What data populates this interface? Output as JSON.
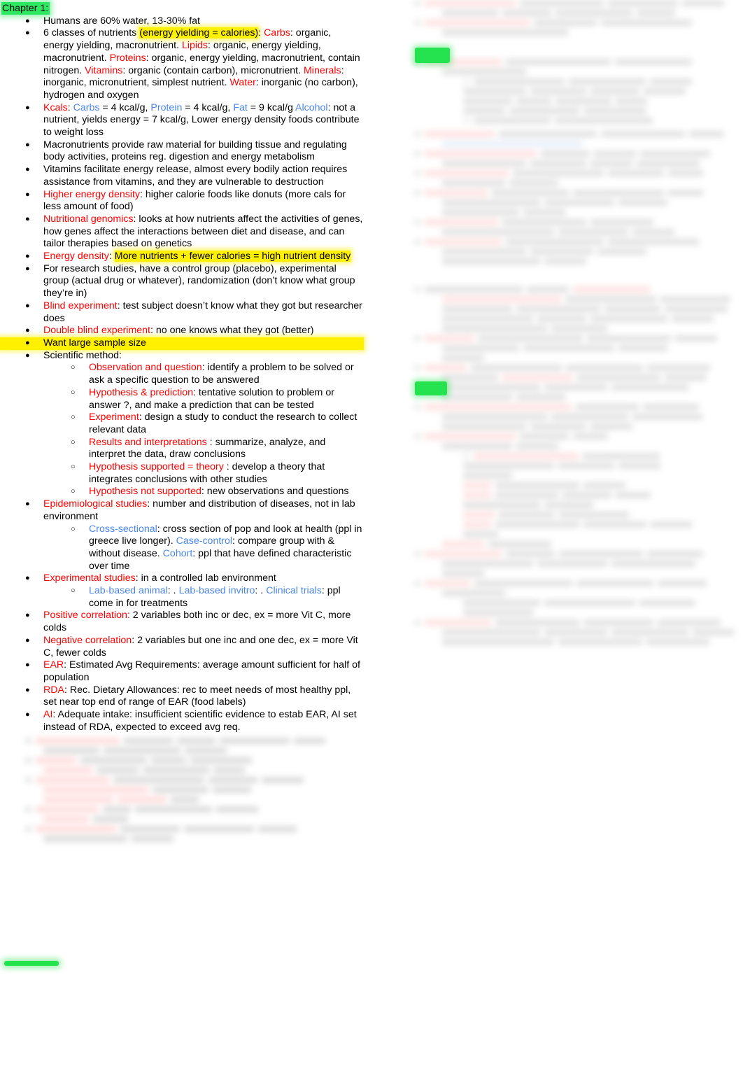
{
  "document": {
    "title": "Chapter 1:",
    "title_highlight": "green",
    "colors": {
      "term_red": "#ff0000",
      "term_blue": "#4a86e8",
      "highlight_yellow": "#fff000",
      "highlight_green": "#2ee861",
      "body_text": "#000000"
    }
  },
  "left_column": {
    "heading": "Chapter 1:",
    "bullets": [
      {
        "id": "humans-water-fat",
        "parts": [
          {
            "text": "Humans are 60% water, 13-30% fat",
            "color": "black"
          }
        ]
      },
      {
        "id": "six-classes-nutrients",
        "parts": [
          {
            "text": "6 classes of nutrients ",
            "color": "black"
          },
          {
            "text": "(energy yielding = calories)",
            "color": "black",
            "highlight": "yellow"
          },
          {
            "text": ": ",
            "color": "black"
          },
          {
            "text": "Carbs",
            "color": "red"
          },
          {
            "text": ": organic, energy yielding, macronutrient. ",
            "color": "black"
          },
          {
            "text": "Lipids",
            "color": "red"
          },
          {
            "text": ": organic, energy yielding, macronutrient. ",
            "color": "black"
          },
          {
            "text": "Proteins",
            "color": "red"
          },
          {
            "text": ": organic, energy yielding, macronutrient, contain nitrogen. ",
            "color": "black"
          },
          {
            "text": "Vitamins",
            "color": "red"
          },
          {
            "text": ": organic (contain carbon), micronutrient. ",
            "color": "black"
          },
          {
            "text": "Minerals",
            "color": "red"
          },
          {
            "text": ": inorganic, micronutrient, simplest nutrient. ",
            "color": "black"
          },
          {
            "text": "Water",
            "color": "red"
          },
          {
            "text": ": inorganic (no carbon), hydrogen and oxygen",
            "color": "black"
          }
        ]
      },
      {
        "id": "kcals",
        "parts": [
          {
            "text": "Kcals",
            "color": "red"
          },
          {
            "text": ": ",
            "color": "black"
          },
          {
            "text": "Carbs",
            "color": "blue"
          },
          {
            "text": " = 4 kcal/g, ",
            "color": "black"
          },
          {
            "text": "Protein",
            "color": "blue"
          },
          {
            "text": " = 4 kcal/g, ",
            "color": "black"
          },
          {
            "text": "Fat",
            "color": "blue"
          },
          {
            "text": " = 9 kcal/g ",
            "color": "black"
          },
          {
            "text": "Alcohol",
            "color": "blue"
          },
          {
            "text": ": not a nutrient, yields energy = 7 kcal/g, Lower energy density foods contribute to weight loss",
            "color": "black"
          }
        ]
      },
      {
        "id": "macronutrients-raw-material",
        "parts": [
          {
            "text": "Macronutrients provide raw material for building tissue and regulating body activities, proteins reg. digestion and energy metabolism",
            "color": "black"
          }
        ]
      },
      {
        "id": "vitamins-facilitate",
        "parts": [
          {
            "text": "Vitamins facilitate energy release, almost every bodily action requires assistance from vitamins, and they are vulnerable to destruction",
            "color": "black"
          }
        ]
      },
      {
        "id": "higher-energy-density",
        "parts": [
          {
            "text": "Higher energy density",
            "color": "red"
          },
          {
            "text": ": higher calorie foods like donuts (more cals for less amount of food)",
            "color": "black"
          }
        ]
      },
      {
        "id": "nutritional-genomics",
        "parts": [
          {
            "text": "Nutritional genomics",
            "color": "red"
          },
          {
            "text": ": looks at how nutrients affect the activities of genes, how genes affect the interactions between diet and disease, and can tailor therapies based on genetics",
            "color": "black"
          }
        ]
      },
      {
        "id": "energy-density",
        "parts": [
          {
            "text": "Energy density",
            "color": "red"
          },
          {
            "text": ": ",
            "color": "black"
          },
          {
            "text": "More nutrients + fewer calories = high nutrient density",
            "color": "black",
            "highlight": "yellow"
          }
        ]
      },
      {
        "id": "research-studies-groups",
        "parts": [
          {
            "text": "For research studies, have a control group (placebo), experimental group (actual drug or whatever), randomization (don’t know what group they’re in)",
            "color": "black"
          }
        ]
      },
      {
        "id": "blind-experiment",
        "parts": [
          {
            "text": "Blind experiment",
            "color": "red"
          },
          {
            "text": ": test subject doesn’t know what they got but researcher does",
            "color": "black"
          }
        ]
      },
      {
        "id": "double-blind-experiment",
        "parts": [
          {
            "text": "Double blind experiment",
            "color": "red"
          },
          {
            "text": ": no one knows what they got (better)",
            "color": "black"
          }
        ]
      },
      {
        "id": "want-large-sample-size",
        "highlight_whole_line": "yellow",
        "parts": [
          {
            "text": "Want large sample size",
            "color": "black"
          }
        ]
      },
      {
        "id": "scientific-method",
        "parts": [
          {
            "text": "Scientific method:",
            "color": "black"
          }
        ],
        "subbullets": [
          {
            "id": "observation-and-question",
            "parts": [
              {
                "text": "Observation and question",
                "color": "red"
              },
              {
                "text": ": identify a problem to be solved or ask a specific question to be answered",
                "color": "black"
              }
            ]
          },
          {
            "id": "hypothesis-and-prediction",
            "parts": [
              {
                "text": "Hypothesis & prediction",
                "color": "red"
              },
              {
                "text": ": tentative solution to problem or answer ?, and make a prediction that can be tested",
                "color": "black"
              }
            ]
          },
          {
            "id": "experiment",
            "parts": [
              {
                "text": "Experiment",
                "color": "red"
              },
              {
                "text": ": design a study to conduct the research to collect relevant data",
                "color": "black"
              }
            ]
          },
          {
            "id": "results-and-interpretations",
            "parts": [
              {
                "text": "Results and interpretations",
                "color": "red"
              },
              {
                "text": " : summarize, analyze, and interpret the data, draw conclusions",
                "color": "black"
              }
            ]
          },
          {
            "id": "hypothesis-supported-theory",
            "parts": [
              {
                "text": "Hypothesis supported = theory",
                "color": "red"
              },
              {
                "text": " : develop a theory that integrates conclusions with other studies",
                "color": "black"
              }
            ]
          },
          {
            "id": "hypothesis-not-supported",
            "parts": [
              {
                "text": "Hypothesis not supported",
                "color": "red"
              },
              {
                "text": ": new observations and questions",
                "color": "black"
              }
            ]
          }
        ]
      },
      {
        "id": "epidemiological-studies",
        "flat_wrap": true,
        "parts": [
          {
            "text": "Epidemiological studies",
            "color": "red"
          },
          {
            "text": ": number and distribution of diseases, not in lab environment",
            "color": "black"
          }
        ],
        "subbullets": [
          {
            "id": "cross-sectional-case-control-cohort",
            "parts": [
              {
                "text": "Cross-sectional",
                "color": "blue"
              },
              {
                "text": ": cross section of pop and look at health (ppl in greece live longer). ",
                "color": "black"
              },
              {
                "text": "Case-control",
                "color": "blue"
              },
              {
                "text": ": compare group with & without disease. ",
                "color": "black"
              },
              {
                "text": "Cohort",
                "color": "blue"
              },
              {
                "text": ": ppl that have defined characteristic over time",
                "color": "black"
              }
            ]
          }
        ]
      },
      {
        "id": "experimental-studies",
        "parts": [
          {
            "text": "Experimental studies",
            "color": "red"
          },
          {
            "text": ": in a controlled lab environment",
            "color": "black"
          }
        ],
        "subbullets": [
          {
            "id": "lab-based-animal-invitro-clinical",
            "parts": [
              {
                "text": "Lab-based animal",
                "color": "blue"
              },
              {
                "text": ": . ",
                "color": "black"
              },
              {
                "text": "Lab-based invitro",
                "color": "blue"
              },
              {
                "text": ": . ",
                "color": "black"
              },
              {
                "text": "Clinical trials",
                "color": "blue"
              },
              {
                "text": ": ppl come in for treatments",
                "color": "black"
              }
            ]
          }
        ]
      },
      {
        "id": "positive-correlation",
        "flat_wrap": true,
        "parts": [
          {
            "text": "Positive correlation:",
            "color": "red"
          },
          {
            "text": " 2 variables both inc or dec, ex = more Vit C, more colds",
            "color": "black"
          }
        ]
      },
      {
        "id": "negative-correlation",
        "flat_wrap": true,
        "parts": [
          {
            "text": "Negative correlation",
            "color": "red"
          },
          {
            "text": ": 2 variables but one inc and one dec, ex = more Vit C, fewer colds",
            "color": "black"
          }
        ]
      },
      {
        "id": "ear",
        "flat_wrap": true,
        "parts": [
          {
            "text": "EAR",
            "color": "red"
          },
          {
            "text": ": Estimated Avg Requirements: average amount sufficient for half of population",
            "color": "black"
          }
        ]
      },
      {
        "id": "rda",
        "flat_wrap": true,
        "parts": [
          {
            "text": "RDA",
            "color": "red"
          },
          {
            "text": ": Rec. Dietary Allowances: rec to meet needs of most healthy ppl, set near top end of range of EAR (food labels)",
            "color": "black"
          }
        ]
      },
      {
        "id": "ai",
        "flat_wrap": true,
        "parts": [
          {
            "text": "AI",
            "color": "red"
          },
          {
            "text": ": Adequate intake: insufficient scientific evidence to estab EAR, AI set instead of RDA, expected to exceed avg req.",
            "color": "black"
          }
        ]
      }
    ],
    "obscured_note": "Remaining lower-left content is blurred and illegible."
  },
  "right_column": {
    "obscured_note": "Entire right column content is blurred and illegible.",
    "visible_markers": [
      {
        "id": "green-marker-top",
        "color": "#25e34f",
        "shape": "highlighter-bar"
      },
      {
        "id": "green-marker-middle",
        "color": "#25e34f",
        "shape": "highlighter-bar"
      }
    ]
  },
  "markers": [
    {
      "id": "green-bar-bottom-left",
      "color": "#25e34f",
      "shape": "highlighter-bar"
    }
  ]
}
